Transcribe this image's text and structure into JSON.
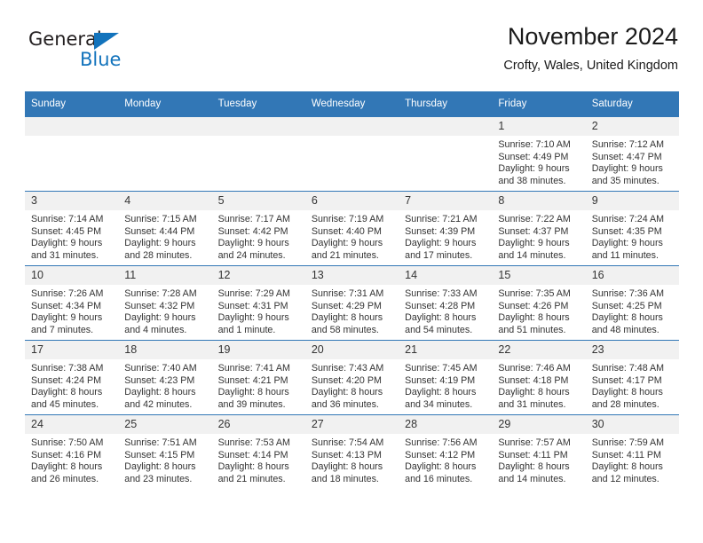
{
  "logo": {
    "word_top": "General",
    "word_bottom": "Blue",
    "triangle_icon": "triangle-icon",
    "color": "#1273bc"
  },
  "header": {
    "title": "November 2024",
    "subtitle": "Crofty, Wales, United Kingdom"
  },
  "theme": {
    "header_blue": "#3277b6",
    "daynum_bg": "#f1f1f1",
    "text": "#333333"
  },
  "calendar": {
    "weekdays": [
      "Sunday",
      "Monday",
      "Tuesday",
      "Wednesday",
      "Thursday",
      "Friday",
      "Saturday"
    ],
    "labels": {
      "sunrise": "Sunrise:",
      "sunset": "Sunset:",
      "daylight": "Daylight:"
    },
    "weeks": [
      [
        {
          "day": "",
          "empty": true
        },
        {
          "day": "",
          "empty": true
        },
        {
          "day": "",
          "empty": true
        },
        {
          "day": "",
          "empty": true
        },
        {
          "day": "",
          "empty": true
        },
        {
          "day": "1",
          "sunrise": "Sunrise: 7:10 AM",
          "sunset": "Sunset: 4:49 PM",
          "daylight": "Daylight: 9 hours and 38 minutes."
        },
        {
          "day": "2",
          "sunrise": "Sunrise: 7:12 AM",
          "sunset": "Sunset: 4:47 PM",
          "daylight": "Daylight: 9 hours and 35 minutes."
        }
      ],
      [
        {
          "day": "3",
          "sunrise": "Sunrise: 7:14 AM",
          "sunset": "Sunset: 4:45 PM",
          "daylight": "Daylight: 9 hours and 31 minutes."
        },
        {
          "day": "4",
          "sunrise": "Sunrise: 7:15 AM",
          "sunset": "Sunset: 4:44 PM",
          "daylight": "Daylight: 9 hours and 28 minutes."
        },
        {
          "day": "5",
          "sunrise": "Sunrise: 7:17 AM",
          "sunset": "Sunset: 4:42 PM",
          "daylight": "Daylight: 9 hours and 24 minutes."
        },
        {
          "day": "6",
          "sunrise": "Sunrise: 7:19 AM",
          "sunset": "Sunset: 4:40 PM",
          "daylight": "Daylight: 9 hours and 21 minutes."
        },
        {
          "day": "7",
          "sunrise": "Sunrise: 7:21 AM",
          "sunset": "Sunset: 4:39 PM",
          "daylight": "Daylight: 9 hours and 17 minutes."
        },
        {
          "day": "8",
          "sunrise": "Sunrise: 7:22 AM",
          "sunset": "Sunset: 4:37 PM",
          "daylight": "Daylight: 9 hours and 14 minutes."
        },
        {
          "day": "9",
          "sunrise": "Sunrise: 7:24 AM",
          "sunset": "Sunset: 4:35 PM",
          "daylight": "Daylight: 9 hours and 11 minutes."
        }
      ],
      [
        {
          "day": "10",
          "sunrise": "Sunrise: 7:26 AM",
          "sunset": "Sunset: 4:34 PM",
          "daylight": "Daylight: 9 hours and 7 minutes."
        },
        {
          "day": "11",
          "sunrise": "Sunrise: 7:28 AM",
          "sunset": "Sunset: 4:32 PM",
          "daylight": "Daylight: 9 hours and 4 minutes."
        },
        {
          "day": "12",
          "sunrise": "Sunrise: 7:29 AM",
          "sunset": "Sunset: 4:31 PM",
          "daylight": "Daylight: 9 hours and 1 minute."
        },
        {
          "day": "13",
          "sunrise": "Sunrise: 7:31 AM",
          "sunset": "Sunset: 4:29 PM",
          "daylight": "Daylight: 8 hours and 58 minutes."
        },
        {
          "day": "14",
          "sunrise": "Sunrise: 7:33 AM",
          "sunset": "Sunset: 4:28 PM",
          "daylight": "Daylight: 8 hours and 54 minutes."
        },
        {
          "day": "15",
          "sunrise": "Sunrise: 7:35 AM",
          "sunset": "Sunset: 4:26 PM",
          "daylight": "Daylight: 8 hours and 51 minutes."
        },
        {
          "day": "16",
          "sunrise": "Sunrise: 7:36 AM",
          "sunset": "Sunset: 4:25 PM",
          "daylight": "Daylight: 8 hours and 48 minutes."
        }
      ],
      [
        {
          "day": "17",
          "sunrise": "Sunrise: 7:38 AM",
          "sunset": "Sunset: 4:24 PM",
          "daylight": "Daylight: 8 hours and 45 minutes."
        },
        {
          "day": "18",
          "sunrise": "Sunrise: 7:40 AM",
          "sunset": "Sunset: 4:23 PM",
          "daylight": "Daylight: 8 hours and 42 minutes."
        },
        {
          "day": "19",
          "sunrise": "Sunrise: 7:41 AM",
          "sunset": "Sunset: 4:21 PM",
          "daylight": "Daylight: 8 hours and 39 minutes."
        },
        {
          "day": "20",
          "sunrise": "Sunrise: 7:43 AM",
          "sunset": "Sunset: 4:20 PM",
          "daylight": "Daylight: 8 hours and 36 minutes."
        },
        {
          "day": "21",
          "sunrise": "Sunrise: 7:45 AM",
          "sunset": "Sunset: 4:19 PM",
          "daylight": "Daylight: 8 hours and 34 minutes."
        },
        {
          "day": "22",
          "sunrise": "Sunrise: 7:46 AM",
          "sunset": "Sunset: 4:18 PM",
          "daylight": "Daylight: 8 hours and 31 minutes."
        },
        {
          "day": "23",
          "sunrise": "Sunrise: 7:48 AM",
          "sunset": "Sunset: 4:17 PM",
          "daylight": "Daylight: 8 hours and 28 minutes."
        }
      ],
      [
        {
          "day": "24",
          "sunrise": "Sunrise: 7:50 AM",
          "sunset": "Sunset: 4:16 PM",
          "daylight": "Daylight: 8 hours and 26 minutes."
        },
        {
          "day": "25",
          "sunrise": "Sunrise: 7:51 AM",
          "sunset": "Sunset: 4:15 PM",
          "daylight": "Daylight: 8 hours and 23 minutes."
        },
        {
          "day": "26",
          "sunrise": "Sunrise: 7:53 AM",
          "sunset": "Sunset: 4:14 PM",
          "daylight": "Daylight: 8 hours and 21 minutes."
        },
        {
          "day": "27",
          "sunrise": "Sunrise: 7:54 AM",
          "sunset": "Sunset: 4:13 PM",
          "daylight": "Daylight: 8 hours and 18 minutes."
        },
        {
          "day": "28",
          "sunrise": "Sunrise: 7:56 AM",
          "sunset": "Sunset: 4:12 PM",
          "daylight": "Daylight: 8 hours and 16 minutes."
        },
        {
          "day": "29",
          "sunrise": "Sunrise: 7:57 AM",
          "sunset": "Sunset: 4:11 PM",
          "daylight": "Daylight: 8 hours and 14 minutes."
        },
        {
          "day": "30",
          "sunrise": "Sunrise: 7:59 AM",
          "sunset": "Sunset: 4:11 PM",
          "daylight": "Daylight: 8 hours and 12 minutes."
        }
      ]
    ]
  }
}
